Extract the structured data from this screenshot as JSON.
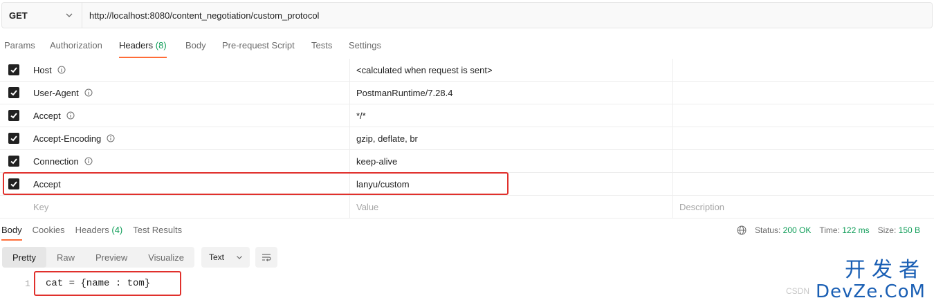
{
  "request": {
    "method": "GET",
    "url": "http://localhost:8080/content_negotiation/custom_protocol"
  },
  "req_tabs": [
    {
      "label": "Params"
    },
    {
      "label": "Authorization"
    },
    {
      "label": "Headers",
      "count": "(8)"
    },
    {
      "label": "Body"
    },
    {
      "label": "Pre-request Script"
    },
    {
      "label": "Tests"
    },
    {
      "label": "Settings"
    }
  ],
  "headers": [
    {
      "key": "Host",
      "value": "<calculated when request is sent>"
    },
    {
      "key": "User-Agent",
      "value": "PostmanRuntime/7.28.4"
    },
    {
      "key": "Accept",
      "value": "*/*"
    },
    {
      "key": "Accept-Encoding",
      "value": "gzip, deflate, br"
    },
    {
      "key": "Connection",
      "value": "keep-alive"
    },
    {
      "key": "Accept",
      "value": "lanyu/custom"
    }
  ],
  "placeholders": {
    "key": "Key",
    "value": "Value",
    "description": "Description"
  },
  "resp_tabs": [
    {
      "label": "Body"
    },
    {
      "label": "Cookies"
    },
    {
      "label": "Headers",
      "count": "(4)"
    },
    {
      "label": "Test Results"
    }
  ],
  "status": {
    "status_label": "Status:",
    "status_value": "200 OK",
    "time_label": "Time:",
    "time_value": "122 ms",
    "size_label": "Size:",
    "size_value": "150 B"
  },
  "view_modes": [
    "Pretty",
    "Raw",
    "Preview",
    "Visualize"
  ],
  "content_type": "Text",
  "code": {
    "line": "1",
    "text": "cat = {name : tom}"
  },
  "watermark": {
    "cn": "开发者",
    "en": "DevZe.CoM",
    "small": "CSDN"
  },
  "colors": {
    "accent": "#ff6c37",
    "status_green": "#0f9d58",
    "highlight_red": "#e0302c"
  }
}
